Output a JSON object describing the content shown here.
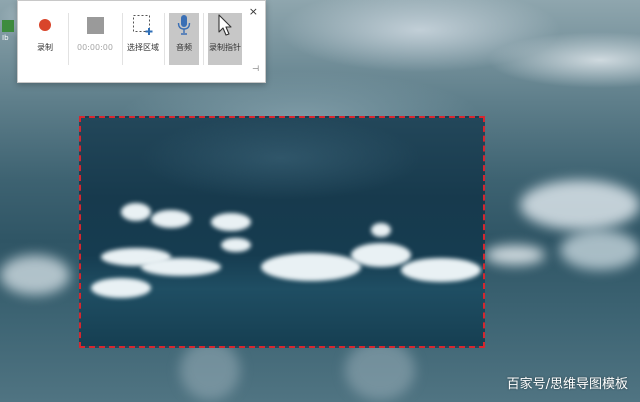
{
  "toolbar": {
    "record_label": "录制",
    "stop_label": "00:00:00",
    "select_area_label": "选择区域",
    "audio_label": "音频",
    "pointer_label": "录制指针",
    "close_glyph": "×",
    "pin_glyph": "⊣"
  },
  "watermark": {
    "text": "百家号/思维导图模板"
  },
  "desktop": {
    "left_icon_label": "Ib"
  },
  "colors": {
    "record": "#d9452b",
    "selection_border": "#d7262f",
    "audio_active_bg": "#c7c7c7",
    "mic": "#3a6fb5"
  },
  "icons": [
    "record-icon",
    "stop-icon",
    "select-area-icon",
    "microphone-icon",
    "pointer-icon",
    "close-icon",
    "pin-icon"
  ]
}
